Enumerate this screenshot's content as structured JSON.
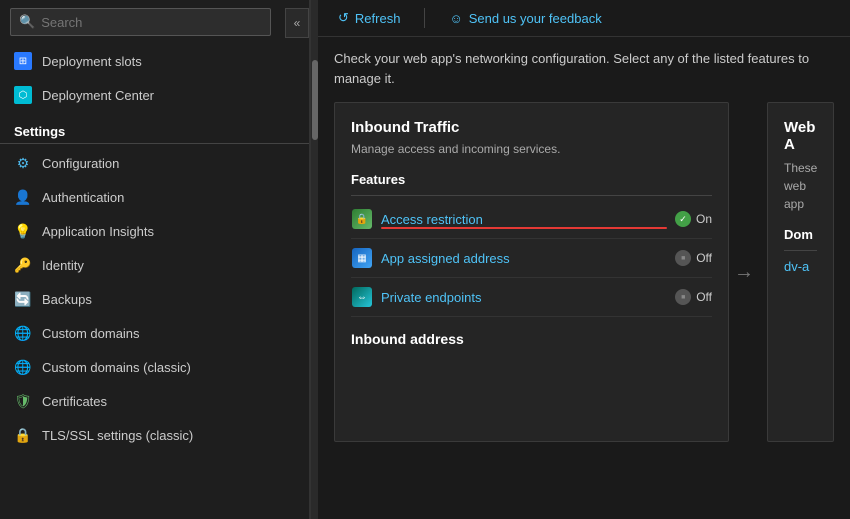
{
  "sidebar": {
    "search_placeholder": "Search",
    "collapse_icon": "«",
    "items_top": [
      {
        "id": "deployment-slots",
        "label": "Deployment slots",
        "icon_type": "ds"
      },
      {
        "id": "deployment-center",
        "label": "Deployment Center",
        "icon_type": "dc"
      }
    ],
    "section_settings": "Settings",
    "items_settings": [
      {
        "id": "configuration",
        "label": "Configuration",
        "icon_type": "cfg"
      },
      {
        "id": "authentication",
        "label": "Authentication",
        "icon_type": "auth"
      },
      {
        "id": "application-insights",
        "label": "Application Insights",
        "icon_type": "ai"
      },
      {
        "id": "identity",
        "label": "Identity",
        "icon_type": "id"
      },
      {
        "id": "backups",
        "label": "Backups",
        "icon_type": "bk"
      },
      {
        "id": "custom-domains",
        "label": "Custom domains",
        "icon_type": "cd"
      },
      {
        "id": "custom-domains-classic",
        "label": "Custom domains (classic)",
        "icon_type": "cdc"
      },
      {
        "id": "certificates",
        "label": "Certificates",
        "icon_type": "cert"
      },
      {
        "id": "tls-ssl-settings",
        "label": "TLS/SSL settings (classic)",
        "icon_type": "tls"
      }
    ]
  },
  "toolbar": {
    "refresh_label": "Refresh",
    "feedback_label": "Send us your feedback",
    "refresh_icon": "↺",
    "feedback_icon": "☺"
  },
  "page": {
    "description": "Check your web app's networking configuration. Select any of the listed features to manage it.",
    "inbound_card": {
      "title": "Inbound Traffic",
      "subtitle": "Manage access and incoming services.",
      "features_header": "Features",
      "features": [
        {
          "id": "access-restriction",
          "label": "Access restriction",
          "icon_type": "green",
          "status_label": "On",
          "status_type": "green",
          "has_underline": true
        },
        {
          "id": "app-assigned-address",
          "label": "App assigned address",
          "icon_type": "blue",
          "status_label": "Off",
          "status_type": "gray"
        },
        {
          "id": "private-endpoints",
          "label": "Private endpoints",
          "icon_type": "teal",
          "status_label": "Off",
          "status_type": "gray"
        }
      ],
      "inbound_address_label": "Inbound address"
    },
    "web_app_card": {
      "title": "Web A",
      "text": "These web app",
      "domain_label": "Dom",
      "domain_value": "dv-a"
    }
  }
}
